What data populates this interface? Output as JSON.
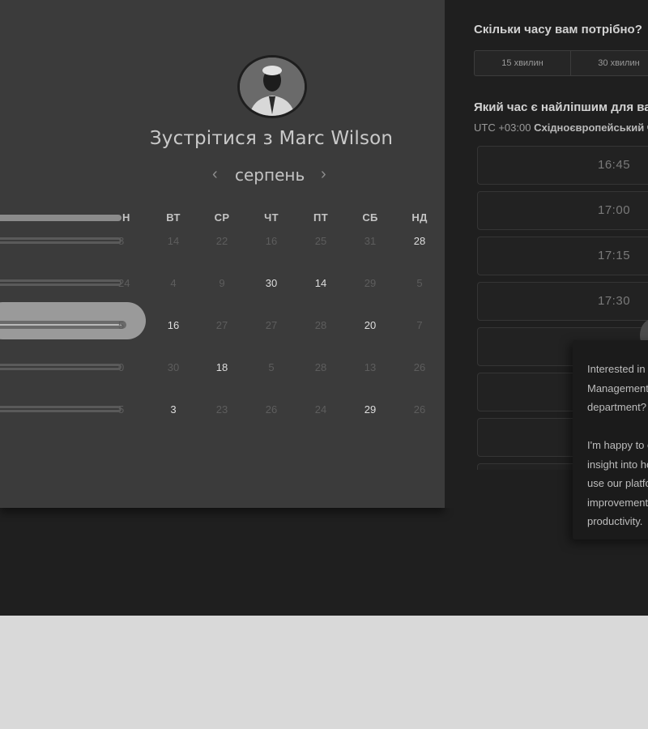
{
  "host": {
    "meet_title": "Зустрітися з Marc Wilson"
  },
  "calendar": {
    "month": "серпень",
    "prev_icon": "‹",
    "next_icon": "›",
    "day_names": [
      "Н",
      "ВТ",
      "СР",
      "ЧТ",
      "ПТ",
      "СБ",
      "НД"
    ],
    "weeks": [
      {
        "first": "8",
        "cells": [
          {
            "v": "14",
            "s": "dim"
          },
          {
            "v": "22",
            "s": "dim"
          },
          {
            "v": "16",
            "s": "dim"
          },
          {
            "v": "25",
            "s": "dim"
          },
          {
            "v": "31",
            "s": "dim"
          },
          {
            "v": "28",
            "s": "bright"
          }
        ]
      },
      {
        "first": "24",
        "cells": [
          {
            "v": "4",
            "s": "dim"
          },
          {
            "v": "9",
            "s": "dim"
          },
          {
            "v": "30",
            "s": "bright"
          },
          {
            "v": "14",
            "s": "bright"
          },
          {
            "v": "29",
            "s": "dim"
          },
          {
            "v": "5",
            "s": "dim"
          }
        ]
      },
      {
        "first": "5",
        "selected": true,
        "cells": [
          {
            "v": "16",
            "s": "bright"
          },
          {
            "v": "27",
            "s": "dim"
          },
          {
            "v": "27",
            "s": "dim"
          },
          {
            "v": "28",
            "s": "dim"
          },
          {
            "v": "20",
            "s": "bright"
          },
          {
            "v": "7",
            "s": "dim"
          }
        ]
      },
      {
        "first": "0",
        "cells": [
          {
            "v": "30",
            "s": "dim"
          },
          {
            "v": "18",
            "s": "bright"
          },
          {
            "v": "5",
            "s": "dim"
          },
          {
            "v": "28",
            "s": "dim"
          },
          {
            "v": "13",
            "s": "dim"
          },
          {
            "v": "26",
            "s": "dim"
          }
        ]
      },
      {
        "first": "5",
        "cells": [
          {
            "v": "3",
            "s": "bright"
          },
          {
            "v": "23",
            "s": "dim"
          },
          {
            "v": "26",
            "s": "dim"
          },
          {
            "v": "24",
            "s": "dim"
          },
          {
            "v": "29",
            "s": "bright"
          },
          {
            "v": "26",
            "s": "dim"
          }
        ]
      }
    ]
  },
  "booking": {
    "duration_question": "Скільки часу вам потрібно?",
    "duration_options": [
      "15 хвилин",
      "30 хвилин"
    ],
    "time_question": "Який час є найліпшим для вас?",
    "timezone_offset": "UTC +03:00",
    "timezone_name": "Східноєвропейський час",
    "slots": [
      "16:45",
      "17:00",
      "17:15",
      "17:30",
      "",
      "",
      "",
      ""
    ]
  },
  "popup": {
    "text": "Interested in learning more about\nManagement and how it can help your\ndepartment?\n\nI'm happy to offer you a free\ninsight into how you can\nuse our platform for\nimprovement and\nproductivity."
  }
}
